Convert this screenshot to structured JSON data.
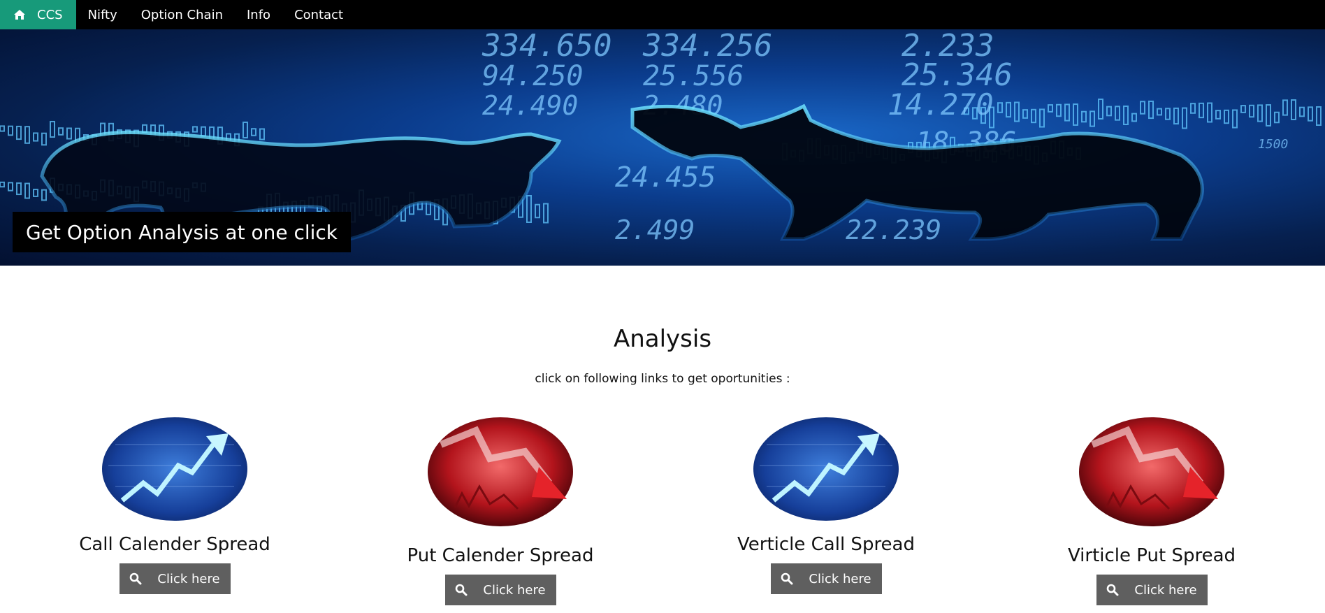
{
  "nav": {
    "items": [
      {
        "label": "CCS",
        "icon": "home-icon",
        "active": true
      },
      {
        "label": "Nifty"
      },
      {
        "label": "Option Chain"
      },
      {
        "label": "Info"
      },
      {
        "label": "Contact"
      }
    ]
  },
  "hero": {
    "caption": "Get Option Analysis at one click",
    "numbers": [
      "334.650",
      "334.256",
      "2.233",
      "94.250",
      "25.556",
      "25.346",
      "24.490",
      "2.480",
      "14.270",
      "18.386",
      "24.455",
      "2.499",
      "22.239",
      "1500"
    ]
  },
  "analysis": {
    "title": "Analysis",
    "subtitle": "click on following links to get oportunities :",
    "cards": [
      {
        "title": "Call Calender Spread",
        "button": "Click here",
        "theme": "blue-up"
      },
      {
        "title": "Put Calender Spread",
        "button": "Click here",
        "theme": "red-down"
      },
      {
        "title": "Verticle Call Spread",
        "button": "Click here",
        "theme": "blue-up"
      },
      {
        "title": "Virticle Put Spread",
        "button": "Click here",
        "theme": "red-down"
      }
    ]
  },
  "colors": {
    "nav_bg": "#000000",
    "nav_active": "#179a7a",
    "button_bg": "#5f5f5f"
  }
}
